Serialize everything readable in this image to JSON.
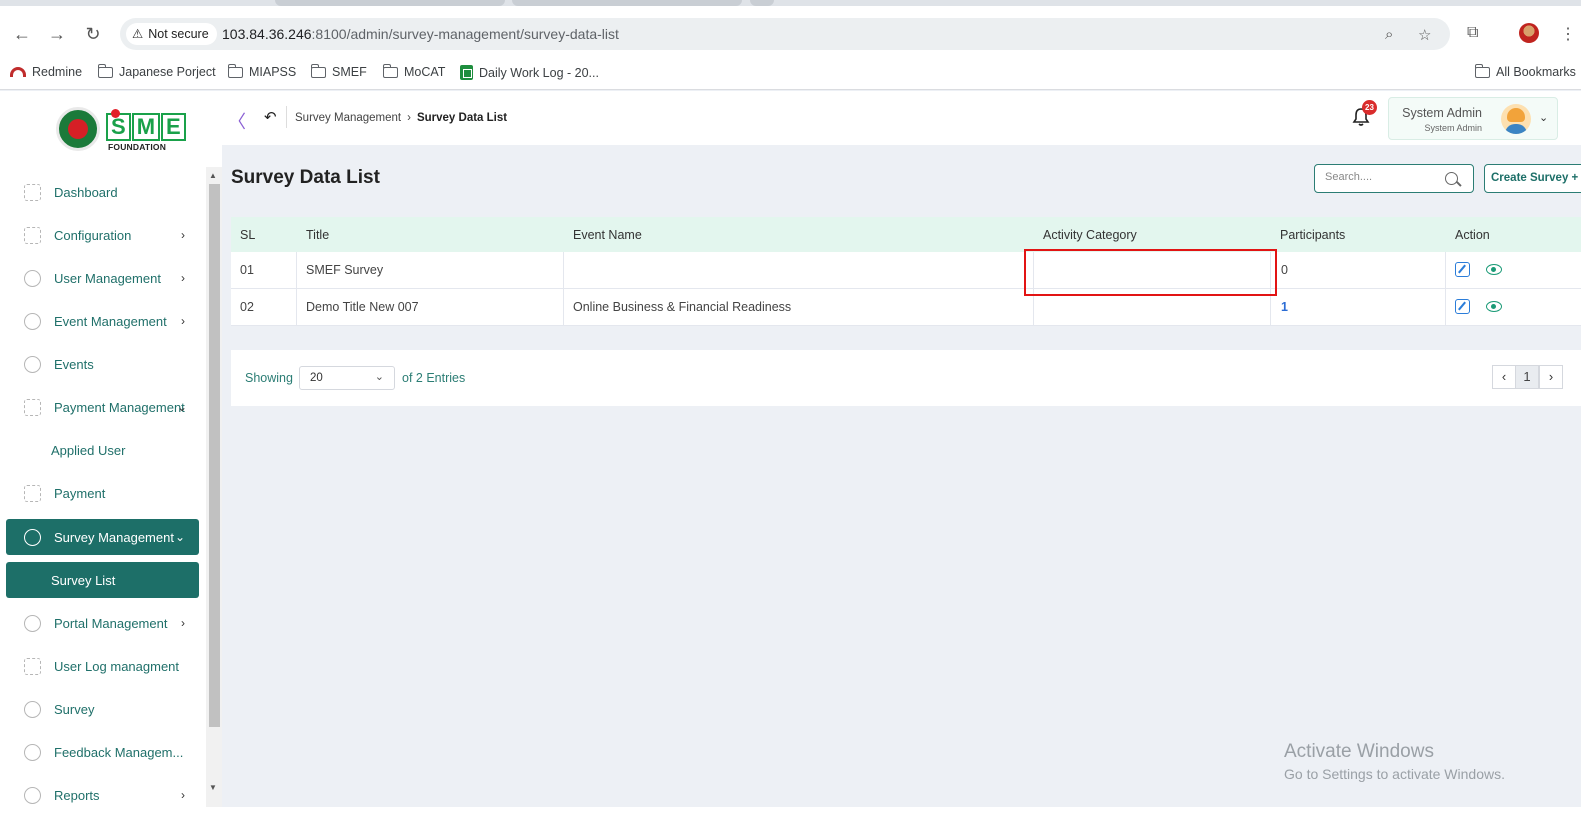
{
  "browser": {
    "security_label": "Not secure",
    "url_host": "103.84.36.246",
    "url_rest": ":8100/admin/survey-management/survey-data-list",
    "bookmarks": [
      {
        "label": "Redmine"
      },
      {
        "label": "Japanese Porject"
      },
      {
        "label": "MIAPSS"
      },
      {
        "label": "SMEF"
      },
      {
        "label": "MoCAT"
      },
      {
        "label": "Daily Work Log - 20..."
      }
    ],
    "all_bookmarks": "All Bookmarks"
  },
  "brand": {
    "logo_text_letters": [
      "S",
      "M",
      "E"
    ],
    "logo_subtitle": "FOUNDATION"
  },
  "header": {
    "breadcrumb_parent": "Survey Management",
    "breadcrumb_current": "Survey Data List",
    "notification_count": "23",
    "user_name": "System Admin",
    "user_role": "System Admin"
  },
  "sidebar": {
    "items": [
      {
        "label": "Dashboard"
      },
      {
        "label": "Configuration"
      },
      {
        "label": "User Management"
      },
      {
        "label": "Event Management"
      },
      {
        "label": "Events"
      },
      {
        "label": "Payment Management"
      },
      {
        "label": "Applied User"
      },
      {
        "label": "Payment"
      },
      {
        "label": "Survey Management"
      },
      {
        "label": "Survey List"
      },
      {
        "label": "Portal Management"
      },
      {
        "label": "User Log managment"
      },
      {
        "label": "Survey"
      },
      {
        "label": "Feedback Managem..."
      },
      {
        "label": "Reports"
      }
    ],
    "active_item": "Survey Management",
    "active_subitem": "Survey List"
  },
  "main": {
    "page_title": "Survey Data List",
    "search_placeholder": "Search....",
    "create_button": "Create Survey +",
    "table": {
      "columns": [
        "SL",
        "Title",
        "Event Name",
        "Activity Category",
        "Participants",
        "Action"
      ],
      "rows": [
        {
          "sl": "01",
          "title": "SMEF Survey",
          "event_name": "",
          "activity_category": "",
          "participants": "0"
        },
        {
          "sl": "02",
          "title": "Demo Title New 007",
          "event_name": "Online Business & Financial Readiness",
          "activity_category": "",
          "participants": "1"
        }
      ]
    },
    "pagination": {
      "showing_label": "Showing",
      "page_size": "20",
      "entries_label": "of 2 Entries",
      "current_page": "1"
    }
  },
  "watermark": {
    "line1": "Activate Windows",
    "line2": "Go to Settings to activate Windows."
  },
  "colors": {
    "primary": "#1d6f68",
    "table_header_bg": "#e3f6ee",
    "highlight": "#e21414",
    "badge": "#d92c2c"
  }
}
